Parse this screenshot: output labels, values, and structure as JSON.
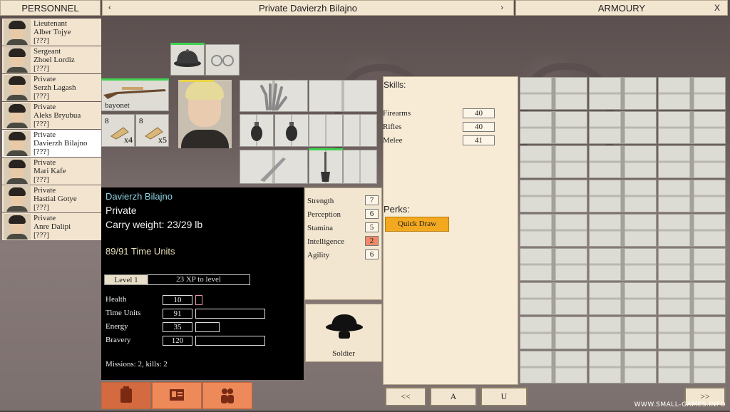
{
  "header": {
    "personnel_label": "PERSONNEL",
    "soldier_title": "Private Davierzh Bilajno",
    "prev_arrow": "‹",
    "next_arrow": "›",
    "armoury_label": "ARMOURY",
    "close_label": "X"
  },
  "roster": [
    {
      "rank": "Lieutenant",
      "name": "Alber Tojye",
      "status": "[???]"
    },
    {
      "rank": "Sergeant",
      "name": "Zhoel Lordiz",
      "status": "[???]"
    },
    {
      "rank": "Private",
      "name": "Serzh Lagash",
      "status": "[???]"
    },
    {
      "rank": "Private",
      "name": "Aleks Bryubua",
      "status": "[???]"
    },
    {
      "rank": "Private",
      "name": "Davierzh Bilajno",
      "status": "[???]",
      "selected": true
    },
    {
      "rank": "Private",
      "name": "Mari Kafe",
      "status": "[???]"
    },
    {
      "rank": "Private",
      "name": "Hastial Gotye",
      "status": "[???]"
    },
    {
      "rank": "Private",
      "name": "Anre Dalipi",
      "status": "[???]"
    }
  ],
  "inventory": {
    "rifle_label": "bayonet",
    "ammo_1_count": "8",
    "ammo_1_multiplier": "x4",
    "ammo_2_count": "8",
    "ammo_2_multiplier": "x5"
  },
  "soldier": {
    "name": "Davierzh Bilajno",
    "rank": "Private",
    "carry_weight": "Carry weight: 23/29 lb",
    "time_units_text": "89/91 Time Units",
    "level": "Level 1",
    "xp_to_level": "23 XP to level",
    "stats": [
      {
        "label": "Health",
        "value": "10",
        "fill": 0.1
      },
      {
        "label": "Time Units",
        "value": "91",
        "fill": 1.0
      },
      {
        "label": "Energy",
        "value": "35",
        "fill": 0.35
      },
      {
        "label": "Bravery",
        "value": "120",
        "fill": 1.0
      }
    ],
    "missions_kills": "Missions: 2, kills: 2"
  },
  "attributes": [
    {
      "label": "Strength",
      "value": "7"
    },
    {
      "label": "Perception",
      "value": "6"
    },
    {
      "label": "Stamina",
      "value": "5"
    },
    {
      "label": "Intelligence",
      "value": "2",
      "highlight_color": "#f08a66"
    },
    {
      "label": "Agility",
      "value": "6"
    }
  ],
  "role": {
    "label": "Soldier",
    "icon": "helmet-icon"
  },
  "skills": {
    "heading": "Skills:",
    "items": [
      {
        "label": "Firearms",
        "value": "40"
      },
      {
        "label": "Rifles",
        "value": "40"
      },
      {
        "label": "Melee",
        "value": "41"
      }
    ],
    "perks_heading": "Perks:",
    "perks": [
      "Quick Draw"
    ]
  },
  "bottom_nav": {
    "prev_label": "<<",
    "a_label": "A",
    "u_label": "U",
    "next_label": ">>"
  },
  "watermark": "WWW.SMALL-GAMES.INFO",
  "colors": {
    "panel_beige": "#f3e6d0",
    "accent_orange": "#ee8a5a",
    "perk_orange": "#f2a81f",
    "status_green": "#3fd14f",
    "name_cyan": "#8fd6e6"
  }
}
